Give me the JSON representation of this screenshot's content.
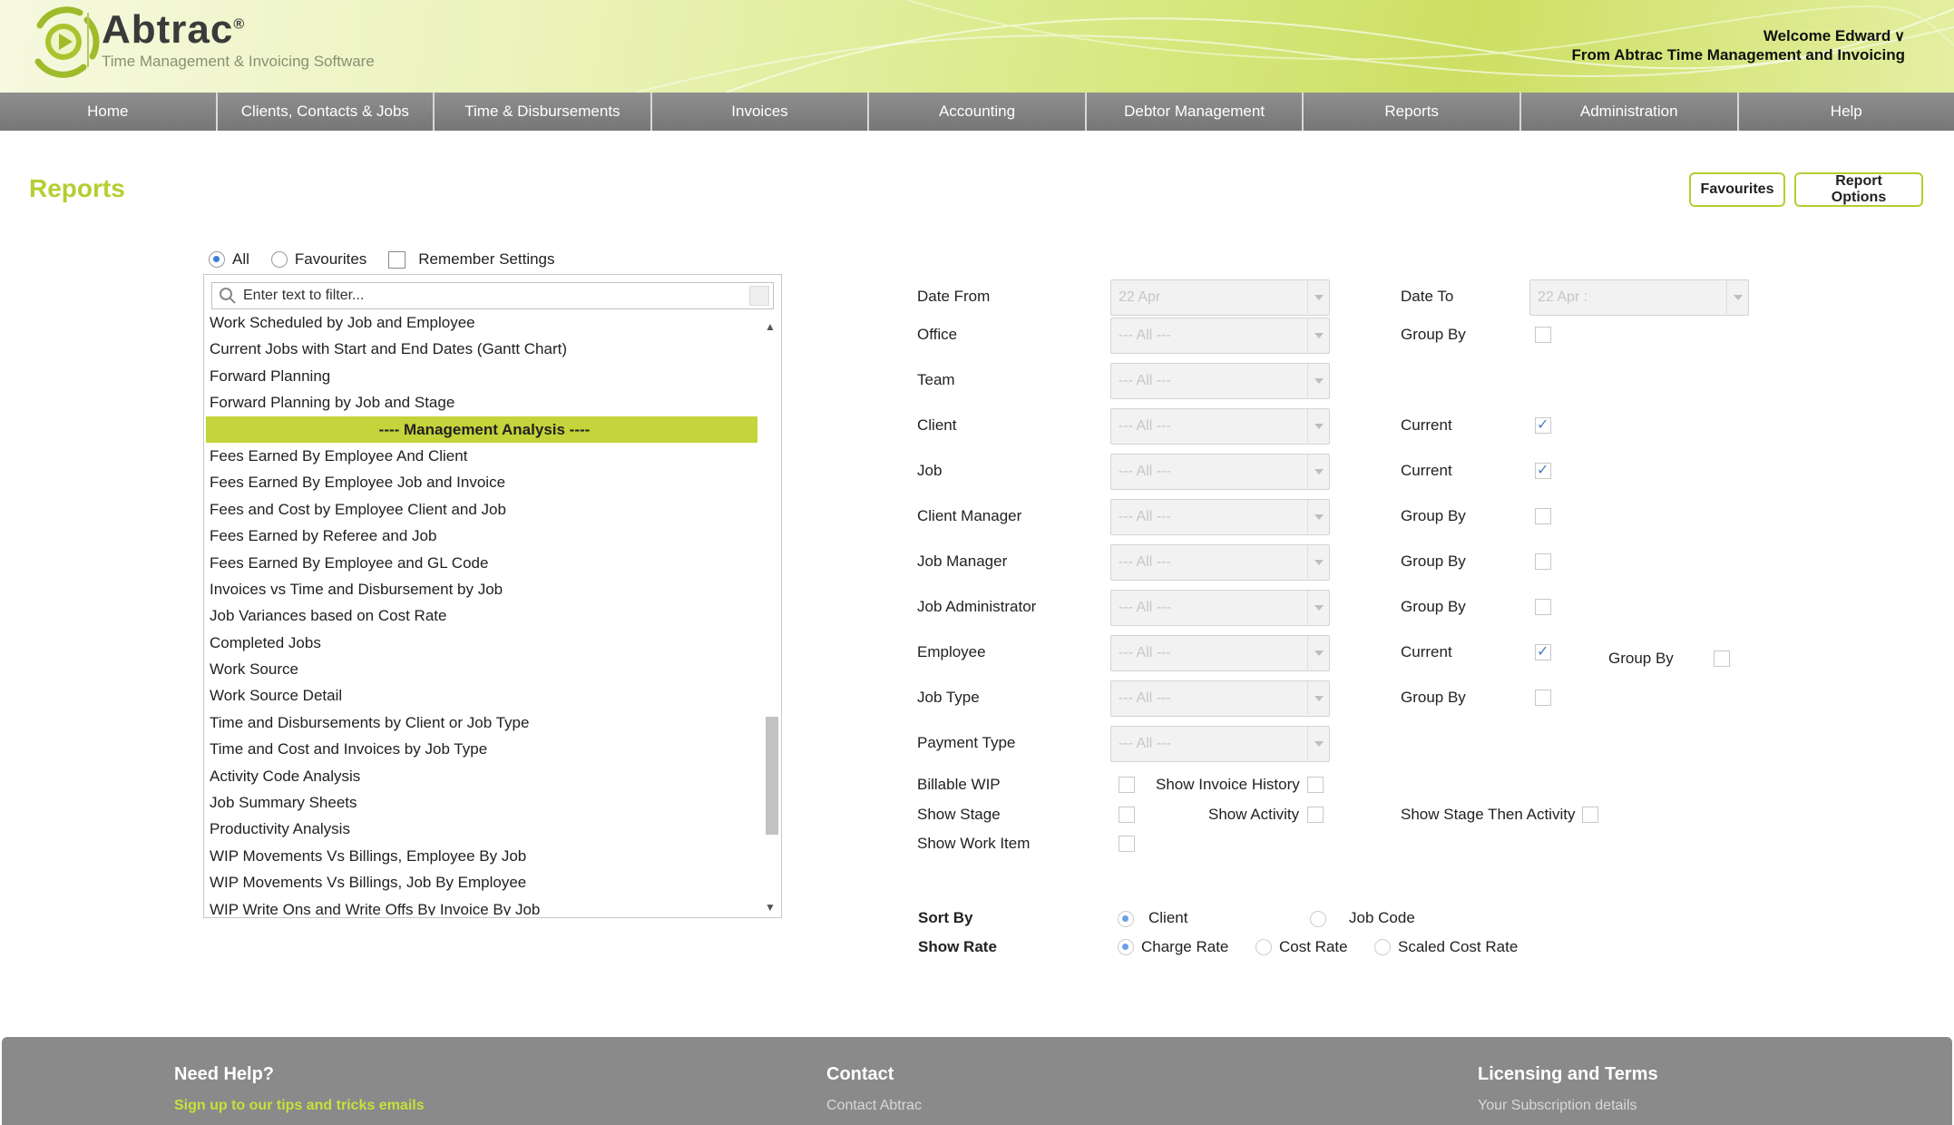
{
  "header": {
    "brand_name": "Abtrac",
    "brand_mark": "®",
    "tagline": "Time Management & Invoicing Software",
    "welcome": "Welcome Edward",
    "org": "From Abtrac Time Management and Invoicing"
  },
  "nav": {
    "items": [
      {
        "label": "Home"
      },
      {
        "label": "Clients, Contacts & Jobs"
      },
      {
        "label": "Time & Disbursements"
      },
      {
        "label": "Invoices"
      },
      {
        "label": "Accounting"
      },
      {
        "label": "Debtor Management"
      },
      {
        "label": "Reports"
      },
      {
        "label": "Administration"
      },
      {
        "label": "Help"
      }
    ]
  },
  "page": {
    "title": "Reports",
    "favourites_button": "Favourites",
    "report_options_button": "Report Options"
  },
  "filters": {
    "all_label": "All",
    "favourites_label": "Favourites",
    "remember_label": "Remember Settings",
    "all_selected": true
  },
  "report_list": {
    "search_placeholder": "Enter text to filter...",
    "items": [
      {
        "label": "Work Scheduled by Job and Employee",
        "header": false
      },
      {
        "label": "Current Jobs with Start and End Dates (Gantt Chart)",
        "header": false
      },
      {
        "label": "Forward Planning",
        "header": false
      },
      {
        "label": "Forward Planning by Job and Stage",
        "header": false
      },
      {
        "label": "---- Management Analysis ----",
        "header": true
      },
      {
        "label": "Fees Earned By Employee And Client",
        "header": false
      },
      {
        "label": "Fees Earned By Employee Job and Invoice",
        "header": false
      },
      {
        "label": "Fees and Cost by Employee Client and Job",
        "header": false
      },
      {
        "label": "Fees Earned by Referee and Job",
        "header": false
      },
      {
        "label": "Fees Earned By Employee and GL Code",
        "header": false
      },
      {
        "label": "Invoices vs Time and Disbursement by Job",
        "header": false
      },
      {
        "label": "Job Variances based on Cost Rate",
        "header": false
      },
      {
        "label": "Completed Jobs",
        "header": false
      },
      {
        "label": "Work Source",
        "header": false
      },
      {
        "label": "Work Source Detail",
        "header": false
      },
      {
        "label": "Time and Disbursements by Client or Job Type",
        "header": false
      },
      {
        "label": "Time and Cost and Invoices by Job Type",
        "header": false
      },
      {
        "label": "Activity Code Analysis",
        "header": false
      },
      {
        "label": "Job Summary Sheets",
        "header": false
      },
      {
        "label": "Productivity Analysis",
        "header": false
      },
      {
        "label": "WIP Movements Vs Billings, Employee By Job",
        "header": false
      },
      {
        "label": "WIP Movements Vs Billings, Job By Employee",
        "header": false
      },
      {
        "label": "WIP Write Ons and Write Offs By Invoice By Job",
        "header": false
      }
    ]
  },
  "options": {
    "date_from": {
      "label": "Date From",
      "value": "22 Apr"
    },
    "date_to": {
      "label": "Date To",
      "value": "22 Apr :"
    },
    "rows": [
      {
        "label": "Office",
        "value": "--- All ---",
        "right_label": "Group By",
        "checked": false
      },
      {
        "label": "Team",
        "value": "--- All ---",
        "right_label": "",
        "checked": false
      },
      {
        "label": "Client",
        "value": "--- All ---",
        "right_label": "Current",
        "checked": true
      },
      {
        "label": "Job",
        "value": "--- All ---",
        "right_label": "Current",
        "checked": true
      },
      {
        "label": "Client Manager",
        "value": "--- All ---",
        "right_label": "Group By",
        "checked": false
      },
      {
        "label": "Job Manager",
        "value": "--- All ---",
        "right_label": "Group By",
        "checked": false
      },
      {
        "label": "Job Administrator",
        "value": "--- All ---",
        "right_label": "Group By",
        "checked": false
      },
      {
        "label": "Employee",
        "value": "--- All ---",
        "right_label": "Current",
        "checked": true
      },
      {
        "label": "Job Type",
        "value": "--- All ---",
        "right_label": "Group By",
        "checked": false
      },
      {
        "label": "Payment Type",
        "value": "--- All ---",
        "right_label": "",
        "checked": false
      }
    ],
    "employee_group_by": "Group By",
    "billable_wip": "Billable WIP",
    "show_invoice_history": "Show Invoice History",
    "show_stage": "Show Stage",
    "show_activity": "Show Activity",
    "show_stage_then_activity": "Show Stage Then Activity",
    "show_work_item": "Show Work Item",
    "sort_by": {
      "label": "Sort By",
      "options": [
        "Client",
        "Job Code"
      ],
      "selected": "Client"
    },
    "show_rate": {
      "label": "Show Rate",
      "options": [
        "Charge Rate",
        "Cost Rate",
        "Scaled Cost Rate"
      ],
      "selected": "Charge Rate"
    }
  },
  "footer": {
    "help_heading": "Need Help?",
    "help_link": "Sign up to our tips and tricks emails",
    "contact_heading": "Contact",
    "contact_link": "Contact Abtrac",
    "licensing_heading": "Licensing and Terms",
    "licensing_link": "Your Subscription details"
  },
  "colors": {
    "accent": "#b6cd32",
    "nav_bg": "#808080",
    "footer_bg": "#8a8a8a",
    "section_highlight": "#c4d43a"
  }
}
